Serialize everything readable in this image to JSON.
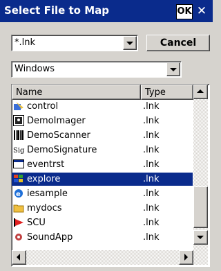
{
  "window": {
    "title": "Select File to Map",
    "ok_label": "OK",
    "close_glyph": "✕"
  },
  "filter": {
    "value": "*.lnk"
  },
  "cancel_label": "Cancel",
  "folder": {
    "value": "Windows"
  },
  "list": {
    "columns": [
      "Name",
      "Type"
    ],
    "rows": [
      {
        "name": "control",
        "type": ".lnk",
        "icon": "control-panel-icon"
      },
      {
        "name": "DemoImager",
        "type": ".lnk",
        "icon": "imager-icon"
      },
      {
        "name": "DemoScanner",
        "type": ".lnk",
        "icon": "barcode-icon"
      },
      {
        "name": "DemoSignature",
        "type": ".lnk",
        "icon": "signature-icon"
      },
      {
        "name": "eventrst",
        "type": ".lnk",
        "icon": "window-icon"
      },
      {
        "name": "explore",
        "type": ".lnk",
        "icon": "explorer-icon",
        "selected": true
      },
      {
        "name": "iesample",
        "type": ".lnk",
        "icon": "internet-explorer-icon"
      },
      {
        "name": "mydocs",
        "type": ".lnk",
        "icon": "folder-icon"
      },
      {
        "name": "SCU",
        "type": ".lnk",
        "icon": "scu-icon"
      },
      {
        "name": "SoundApp",
        "type": ".lnk",
        "icon": "sound-icon"
      }
    ]
  },
  "colors": {
    "title_bar": "#0a2b8c",
    "selection": "#0a2b8c",
    "face": "#d6d3ce"
  }
}
